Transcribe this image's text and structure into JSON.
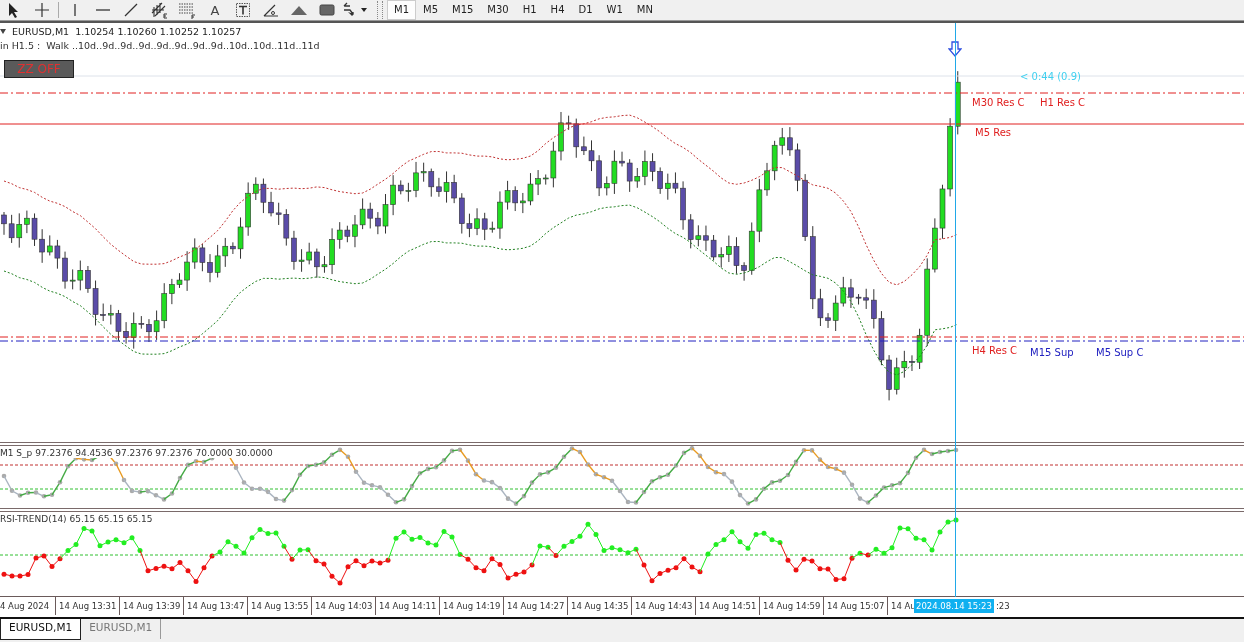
{
  "toolbar": {
    "text_tool": "A",
    "timeframes": [
      {
        "label": "M1",
        "selected": true
      },
      {
        "label": "M5",
        "selected": false
      },
      {
        "label": "M15",
        "selected": false
      },
      {
        "label": "M30",
        "selected": false
      },
      {
        "label": "H1",
        "selected": false
      },
      {
        "label": "H4",
        "selected": false
      },
      {
        "label": "D1",
        "selected": false
      },
      {
        "label": "W1",
        "selected": false
      },
      {
        "label": "MN",
        "selected": false
      }
    ]
  },
  "chart": {
    "symbol": "EURUSD,M1",
    "ohlc": "1.10254 1.10260 1.10252 1.10257",
    "info": "in H1.5 :  Walk ..10d..9d..9d..9d..9d..9d..9d..9d..10d..10d..11d..11d",
    "button": "ZZ OFF",
    "countdown": "< 0:44 (0.9)",
    "levels": [
      {
        "label": "M30 Res C",
        "color": "#e02020"
      },
      {
        "label": "H1 Res C",
        "color": "#e02020"
      },
      {
        "label": "M5 Res",
        "color": "#e02020"
      },
      {
        "label": "H4 Res C",
        "color": "#e02020"
      },
      {
        "label": "M15 Sup",
        "color": "#2020c0"
      },
      {
        "label": "M5 Sup C",
        "color": "#2020c0"
      }
    ]
  },
  "oscillator": {
    "header": "M1 S_p 97.2376 94.4536 97.2376 97.2376 70.0000 30.0000"
  },
  "rsi": {
    "header": "RSI-TREND(14) 65.15 65.15 65.15"
  },
  "time_axis": {
    "labels": [
      "4 Aug 2024",
      "14 Aug 13:31",
      "14 Aug 13:39",
      "14 Aug 13:47",
      "14 Aug 13:55",
      "14 Aug 14:03",
      "14 Aug 14:11",
      "14 Aug 14:19",
      "14 Aug 14:27",
      "14 Aug 14:35",
      "14 Aug 14:43",
      "14 Aug 14:51",
      "14 Aug 14:59",
      "14 Aug 15:07",
      "14 Au"
    ],
    "cursor_time": "2024.08.14 15:23",
    "trailing": ":23"
  },
  "tabs": [
    {
      "label": "EURUSD,M1",
      "selected": true
    },
    {
      "label": "EURUSD,M1",
      "selected": false
    }
  ]
}
